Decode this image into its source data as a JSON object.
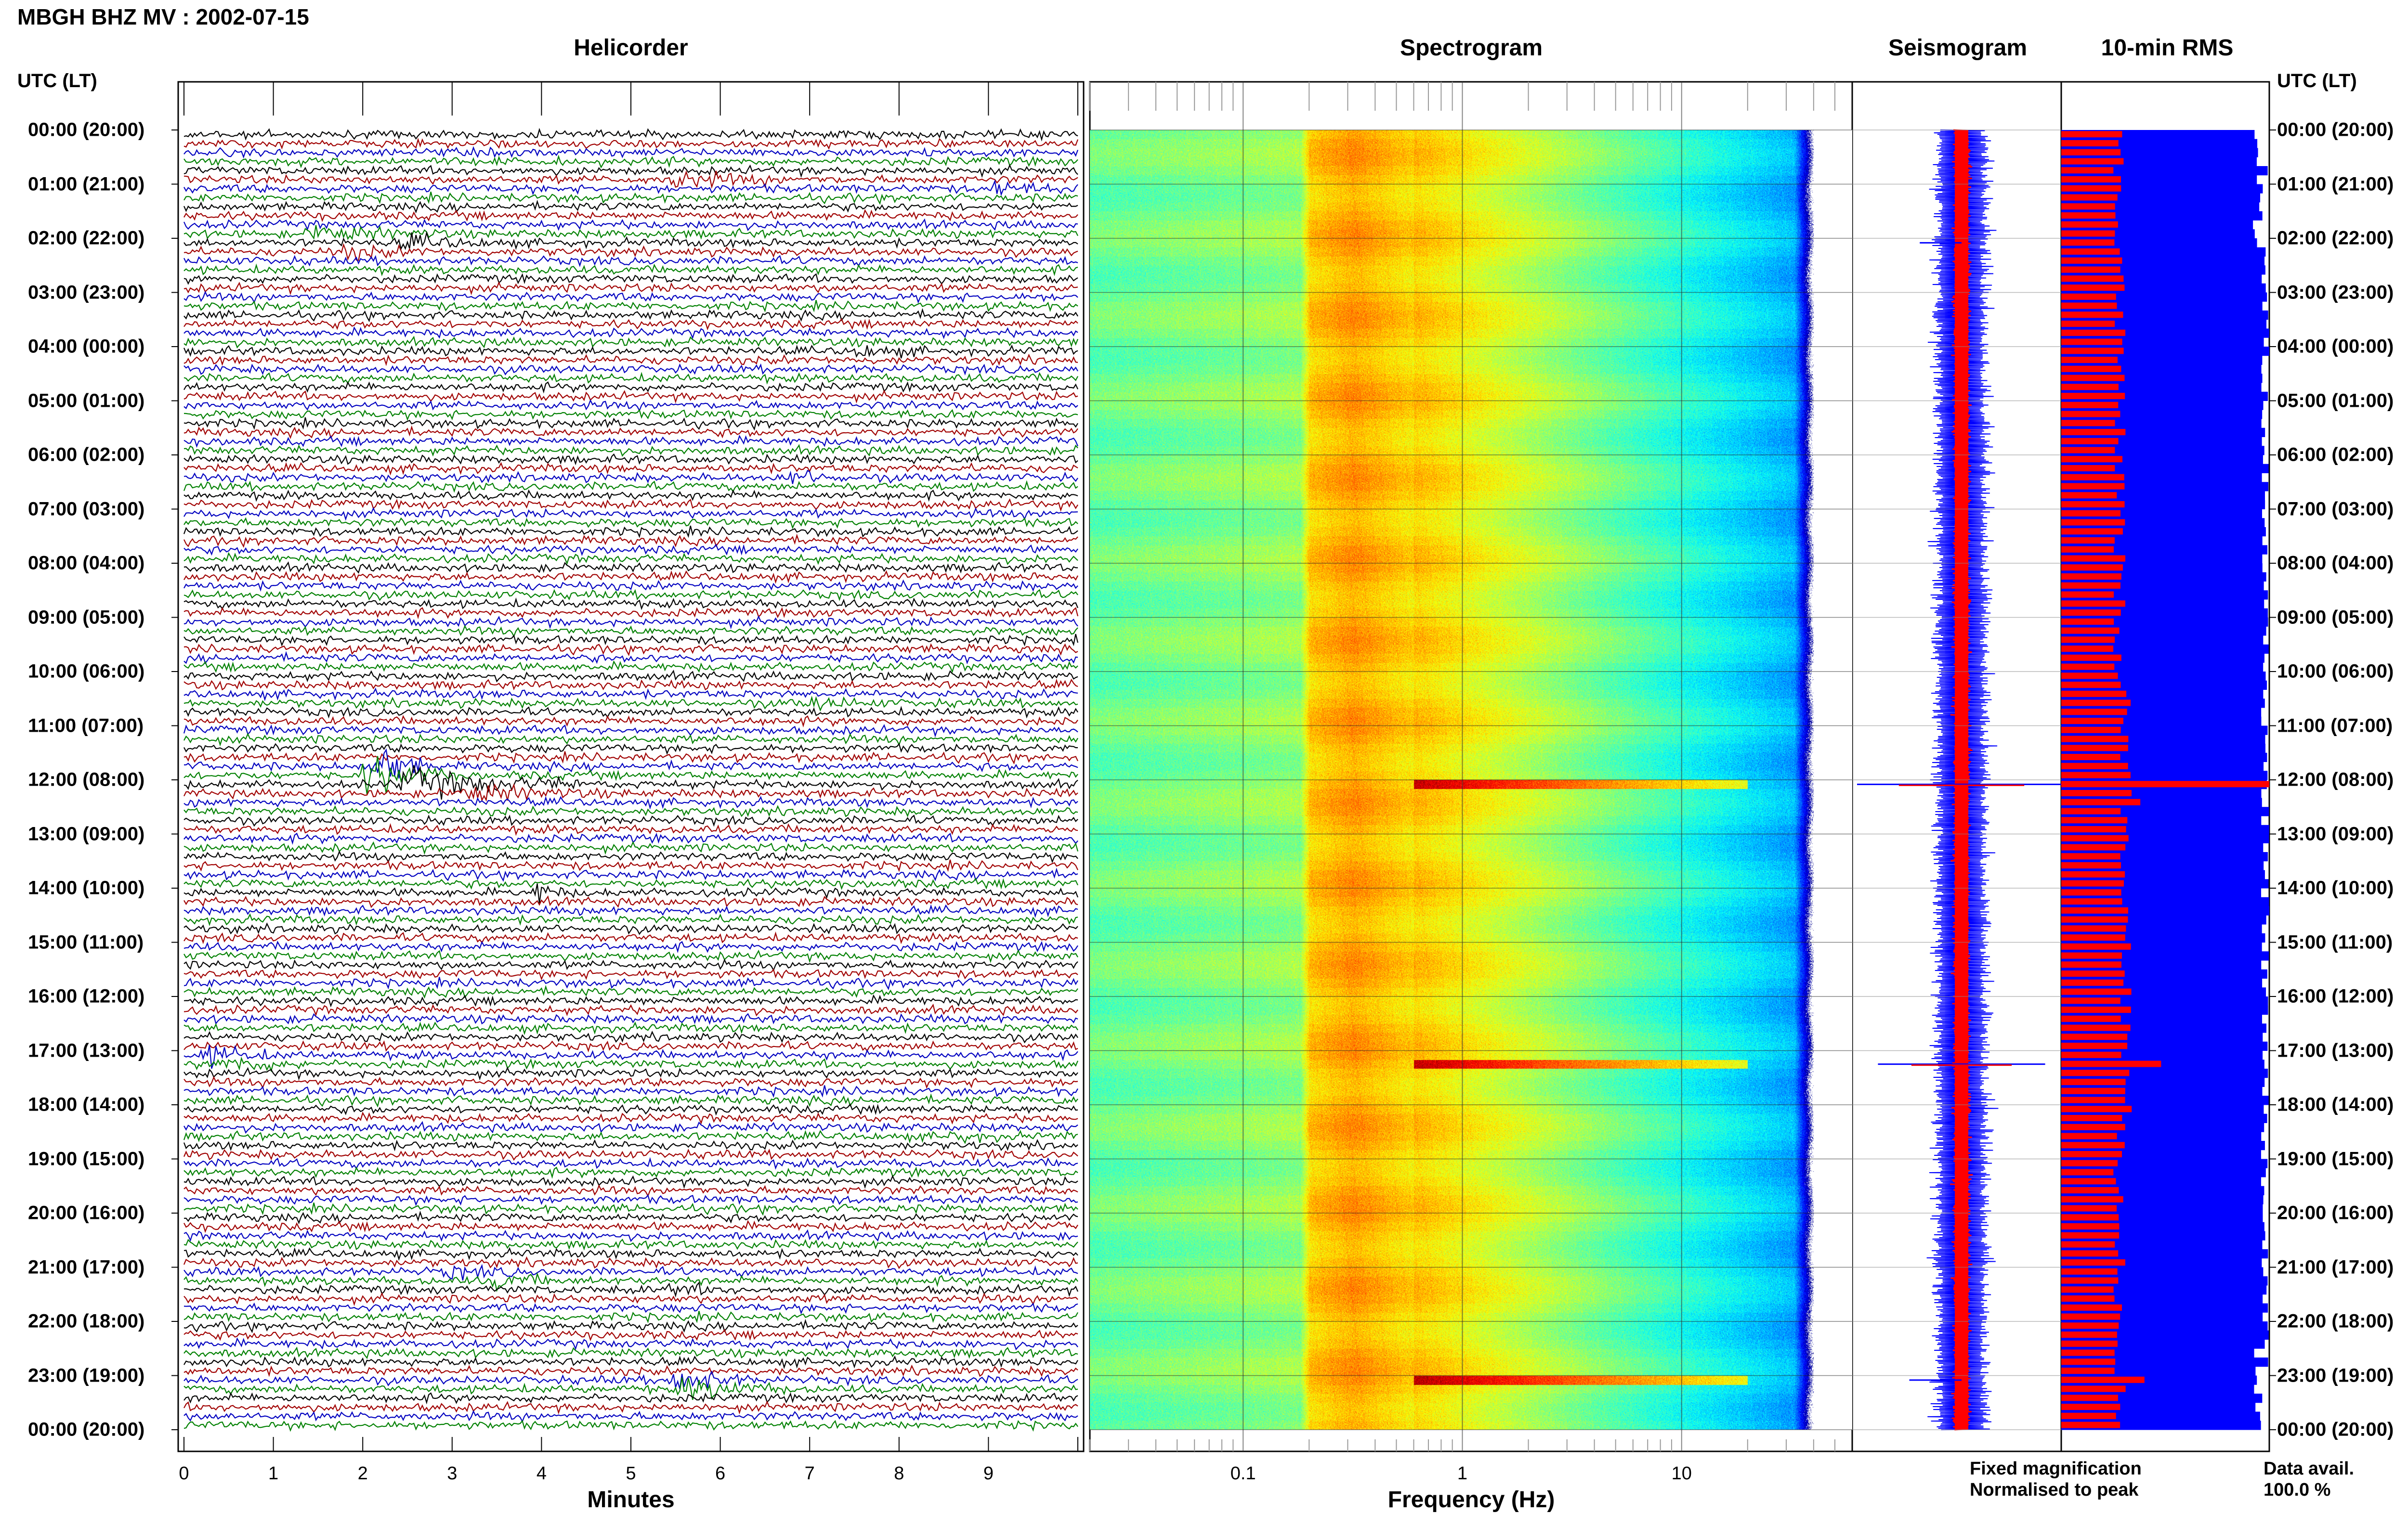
{
  "title": "MBGH BHZ MV : 2002-07-15",
  "panels": {
    "helicorder": "Helicorder",
    "spectrogram": "Spectrogram",
    "seismogram": "Seismogram",
    "rms": "10-min RMS"
  },
  "utc_header": "UTC (LT)",
  "time_labels": [
    "00:00 (20:00)",
    "01:00 (21:00)",
    "02:00 (22:00)",
    "03:00 (23:00)",
    "04:00 (00:00)",
    "05:00 (01:00)",
    "06:00 (02:00)",
    "07:00 (03:00)",
    "08:00 (04:00)",
    "09:00 (05:00)",
    "10:00 (06:00)",
    "11:00 (07:00)",
    "12:00 (08:00)",
    "13:00 (09:00)",
    "14:00 (10:00)",
    "15:00 (11:00)",
    "16:00 (12:00)",
    "17:00 (13:00)",
    "18:00 (14:00)",
    "19:00 (15:00)",
    "20:00 (16:00)",
    "21:00 (17:00)",
    "22:00 (18:00)",
    "23:00 (19:00)",
    "00:00 (20:00)"
  ],
  "legend": {
    "fixed": "Fixed magnification",
    "normalised": "Normalised to peak",
    "data_avail_label": "Data avail.",
    "data_avail_value": "100.0 %"
  },
  "colors": {
    "trace_cycle": [
      "#000000",
      "#a00000",
      "#0000c0",
      "#008000"
    ],
    "seismo_fixed": "#0000ff",
    "seismo_norm": "#ff0000",
    "rms_fixed": "#0000ff",
    "rms_norm": "#ff0000",
    "legend_fixed": "#0000ff",
    "legend_norm": "#ff0000"
  },
  "chart_data": [
    {
      "type": "line",
      "title": "Helicorder",
      "xlabel": "Minutes",
      "x_ticks": [
        "0",
        "1",
        "2",
        "3",
        "4",
        "5",
        "6",
        "7",
        "8",
        "9"
      ],
      "xlim": [
        0,
        10
      ],
      "rows": 144,
      "row_minutes": 10,
      "events": [
        {
          "row": 5,
          "minute": 5.5,
          "amp": 1.8,
          "dur": 1.2
        },
        {
          "row": 6,
          "minute": 9.0,
          "amp": 1.5,
          "dur": 0.8
        },
        {
          "row": 11,
          "minute": 1.5,
          "amp": 1.6,
          "dur": 1.5
        },
        {
          "row": 12,
          "minute": 2.5,
          "amp": 1.4,
          "dur": 1.2
        },
        {
          "row": 13,
          "minute": 1.8,
          "amp": 1.5,
          "dur": 1.0
        },
        {
          "row": 24,
          "minute": 7.5,
          "amp": 1.3,
          "dur": 0.8
        },
        {
          "row": 38,
          "minute": 6.8,
          "amp": 1.4,
          "dur": 0.8
        },
        {
          "row": 63,
          "minute": 7.0,
          "amp": 1.2,
          "dur": 0.8
        },
        {
          "row": 70,
          "minute": 2.2,
          "amp": 6.0,
          "dur": 0.6
        },
        {
          "row": 71,
          "minute": 2.1,
          "amp": 5.0,
          "dur": 0.9
        },
        {
          "row": 72,
          "minute": 2.5,
          "amp": 3.5,
          "dur": 2.0
        },
        {
          "row": 73,
          "minute": 3.2,
          "amp": 2.0,
          "dur": 1.5
        },
        {
          "row": 84,
          "minute": 4.0,
          "amp": 3.0,
          "dur": 0.3
        },
        {
          "row": 102,
          "minute": 0.3,
          "amp": 2.5,
          "dur": 0.8
        },
        {
          "row": 103,
          "minute": 0.5,
          "amp": 2.0,
          "dur": 1.0
        },
        {
          "row": 111,
          "minute": 8.5,
          "amp": 1.3,
          "dur": 0.6
        },
        {
          "row": 126,
          "minute": 3.0,
          "amp": 1.3,
          "dur": 0.8
        },
        {
          "row": 127,
          "minute": 3.5,
          "amp": 1.5,
          "dur": 0.8
        },
        {
          "row": 128,
          "minute": 5.5,
          "amp": 1.2,
          "dur": 0.6
        },
        {
          "row": 138,
          "minute": 5.5,
          "amp": 3.5,
          "dur": 0.8
        },
        {
          "row": 139,
          "minute": 5.6,
          "amp": 2.5,
          "dur": 1.2
        }
      ]
    },
    {
      "type": "heatmap",
      "title": "Spectrogram",
      "xlabel": "Frequency (Hz)",
      "x_scale": "log",
      "xlim": [
        0.02,
        60
      ],
      "x_ticks": [
        0.1,
        1,
        10
      ],
      "x_tick_labels": [
        "0.1",
        "1",
        "10"
      ],
      "data_max_freq": 40,
      "peak_band_hz": [
        0.2,
        0.6
      ],
      "highlight_rows": [
        72,
        103,
        138
      ]
    },
    {
      "type": "line",
      "title": "Seismogram",
      "series": [
        "Fixed magnification",
        "Normalised to peak"
      ],
      "spikes": [
        {
          "row": 12,
          "side": "left",
          "size": 0.4
        },
        {
          "row": 72,
          "side": "both",
          "size": 1.0
        },
        {
          "row": 103,
          "side": "both",
          "size": 0.8
        },
        {
          "row": 138,
          "side": "left",
          "size": 0.5
        }
      ]
    },
    {
      "type": "bar",
      "title": "10-min RMS",
      "series": [
        "Fixed magnification",
        "Normalised to peak"
      ],
      "rows": 144,
      "peaks": [
        {
          "row": 72,
          "norm": 1.0
        },
        {
          "row": 74,
          "norm": 0.38
        },
        {
          "row": 103,
          "norm": 0.48
        },
        {
          "row": 138,
          "norm": 0.4
        }
      ],
      "baseline_norm": 0.25
    }
  ]
}
